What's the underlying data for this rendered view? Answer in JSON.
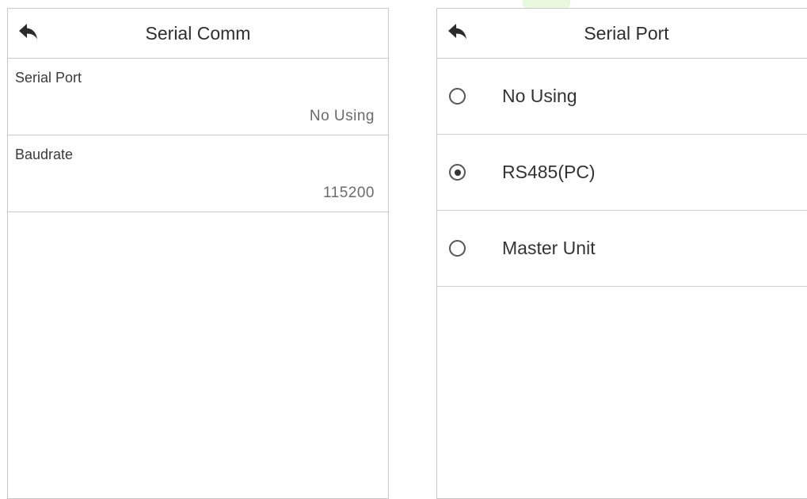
{
  "colors": {
    "background": "#ffffff",
    "border": "#c8c8c8",
    "text": "#333333",
    "value_text": "#6a6a6a"
  },
  "serial_comm": {
    "back_icon": "back-arrow-icon",
    "title": "Serial Comm",
    "items": [
      {
        "label": "Serial Port",
        "value": "No Using"
      },
      {
        "label": "Baudrate",
        "value": "115200"
      }
    ]
  },
  "serial_port": {
    "back_icon": "back-arrow-icon",
    "title": "Serial Port",
    "selected": "RS485(PC)",
    "options": [
      {
        "label": "No Using",
        "selected": false
      },
      {
        "label": "RS485(PC)",
        "selected": true
      },
      {
        "label": "Master Unit",
        "selected": false
      }
    ]
  }
}
